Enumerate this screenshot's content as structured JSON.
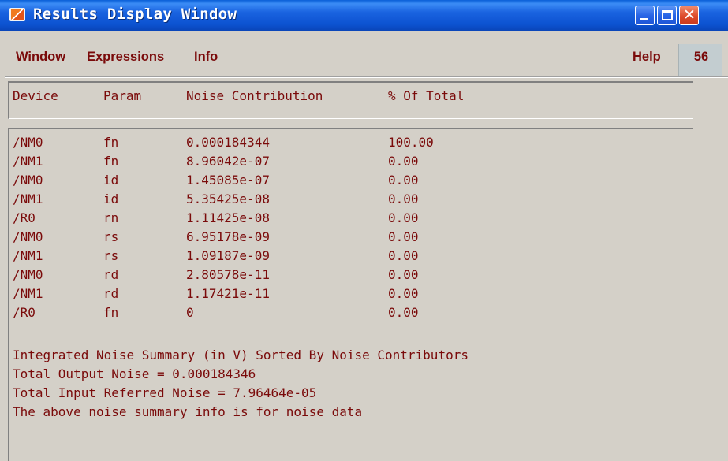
{
  "window": {
    "title": "Results Display Window",
    "icon": "cadence-app-icon"
  },
  "titlebar_buttons": [
    "minimize-icon",
    "maximize-icon",
    "close-icon"
  ],
  "menu": {
    "window_label": "Window",
    "expressions_label": "Expressions",
    "info_label": "Info",
    "help_label": "Help",
    "counter": "56"
  },
  "table": {
    "headers": {
      "device": "Device",
      "param": "Param",
      "noise": "Noise Contribution",
      "percent": "% Of Total"
    },
    "rows": [
      {
        "device": "/NM0",
        "param": "fn",
        "noise": "0.000184344",
        "percent": "100.00"
      },
      {
        "device": "/NM1",
        "param": "fn",
        "noise": "8.96042e-07",
        "percent": "0.00"
      },
      {
        "device": "/NM0",
        "param": "id",
        "noise": "1.45085e-07",
        "percent": "0.00"
      },
      {
        "device": "/NM1",
        "param": "id",
        "noise": "5.35425e-08",
        "percent": "0.00"
      },
      {
        "device": "/R0",
        "param": "rn",
        "noise": "1.11425e-08",
        "percent": "0.00"
      },
      {
        "device": "/NM0",
        "param": "rs",
        "noise": "6.95178e-09",
        "percent": "0.00"
      },
      {
        "device": "/NM1",
        "param": "rs",
        "noise": "1.09187e-09",
        "percent": "0.00"
      },
      {
        "device": "/NM0",
        "param": "rd",
        "noise": "2.80578e-11",
        "percent": "0.00"
      },
      {
        "device": "/NM1",
        "param": "rd",
        "noise": "1.17421e-11",
        "percent": "0.00"
      },
      {
        "device": "/R0",
        "param": "fn",
        "noise": "0",
        "percent": "0.00"
      }
    ]
  },
  "summary": {
    "line1": "Integrated Noise Summary (in V) Sorted By Noise Contributors",
    "line2": "Total Output Noise = 0.000184346",
    "line3": "Total Input Referred Noise = 7.96464e-05",
    "line4": "The above noise summary info is for noise data"
  },
  "colors": {
    "text": "#7a0a0a",
    "titlebar": "#0c52d0",
    "background": "#d4d0c8"
  }
}
